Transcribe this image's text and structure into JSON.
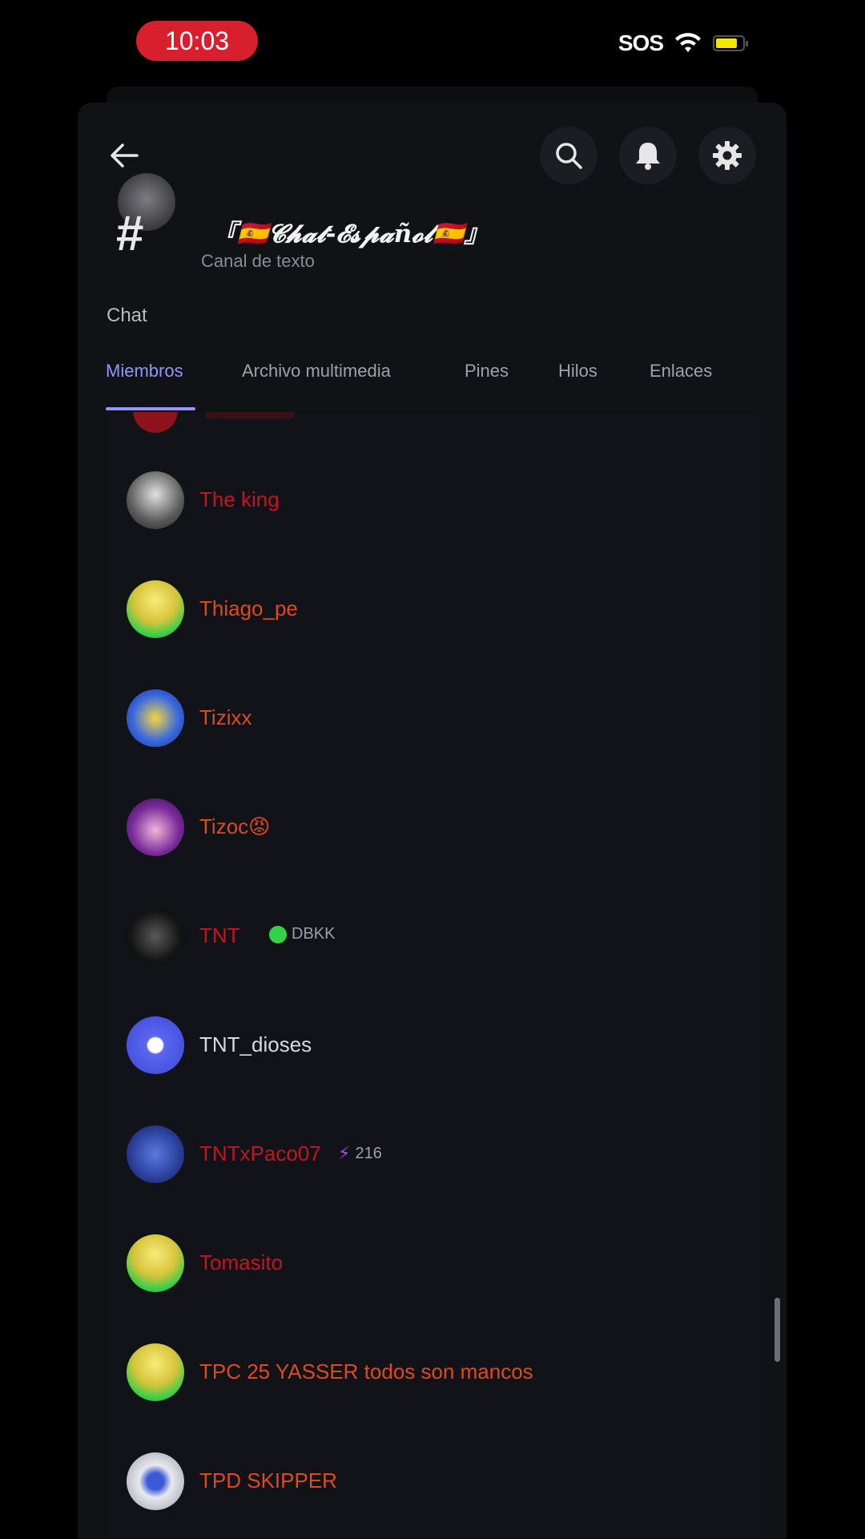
{
  "status": {
    "time": "10:03",
    "sos": "SOS",
    "battery_color": "#f2e600"
  },
  "header": {
    "channel_title": "『🇪🇸𝓒𝓱𝓪𝓽-𝓔𝓼𝓹𝓪ñ𝓸𝓵🇪🇸』",
    "channel_subtitle": "Canal de texto",
    "section_label": "Chat",
    "icons": [
      "back-arrow-icon",
      "search-icon",
      "bell-icon",
      "gear-icon"
    ]
  },
  "tabs": [
    {
      "label": "Miembros",
      "active": true
    },
    {
      "label": "Archivo multimedia",
      "active": false
    },
    {
      "label": "Pines",
      "active": false
    },
    {
      "label": "Hilos",
      "active": false
    },
    {
      "label": "Enlaces",
      "active": false
    }
  ],
  "members": [
    {
      "name": "The king",
      "color": "#c4141f",
      "avatar": "#8a8a8a",
      "tag": ""
    },
    {
      "name": "Thiago_pe",
      "color": "#e0491c",
      "avatar": "#3ec34a",
      "tag": ""
    },
    {
      "name": "Tizixx",
      "color": "#e0491c",
      "avatar": "#2f5bd8",
      "tag": ""
    },
    {
      "name": "Tizoc😡",
      "color": "#e0491c",
      "avatar": "#6a2a8a",
      "tag": ""
    },
    {
      "name": "TNT",
      "color": "#c4141f",
      "avatar": "#1a1a1a",
      "tag": "DBKK"
    },
    {
      "name": "TNT_dioses",
      "color": "#d8d9dc",
      "avatar": "#4f5dea",
      "tag": ""
    },
    {
      "name": "TNTxPaco07",
      "color": "#c4141f",
      "avatar": "#2a3f9a",
      "tag": "216"
    },
    {
      "name": "Tomasito",
      "color": "#c4141f",
      "avatar": "#3ec34a",
      "tag": ""
    },
    {
      "name": "TPC 25 YASSER todos son mancos",
      "color": "#e0491c",
      "avatar": "#3ec34a",
      "tag": ""
    },
    {
      "name": "TPD SKIPPER",
      "color": "#e0491c",
      "avatar": "#c8c8d0",
      "tag": ""
    }
  ]
}
